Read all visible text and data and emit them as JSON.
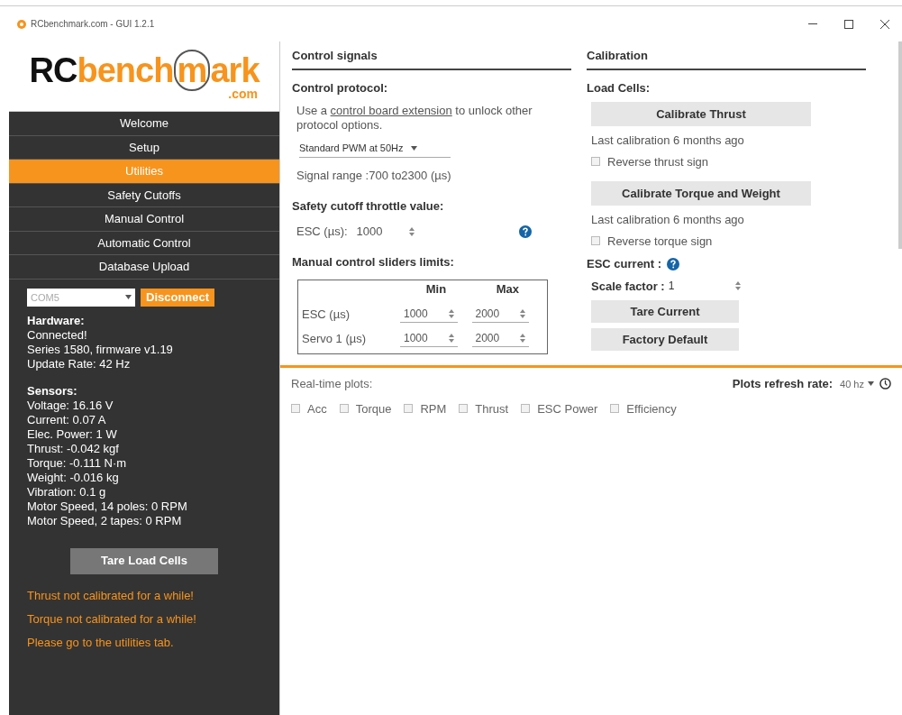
{
  "window": {
    "title": "RCbenchmark.com - GUI 1.2.1"
  },
  "logo": {
    "main": "RCbench",
    "accent": "m",
    "tail": "ark",
    "domain": ".com"
  },
  "nav": [
    {
      "label": "Welcome",
      "selected": false
    },
    {
      "label": "Setup",
      "selected": false
    },
    {
      "label": "Utilities",
      "selected": true
    },
    {
      "label": "Safety Cutoffs",
      "selected": false
    },
    {
      "label": "Manual Control",
      "selected": false
    },
    {
      "label": "Automatic Control",
      "selected": false
    },
    {
      "label": "Database Upload",
      "selected": false
    }
  ],
  "port": {
    "value": "COM5",
    "button": "Disconnect"
  },
  "hardware": {
    "title": "Hardware:",
    "lines": [
      "Connected!",
      "Series 1580, firmware v1.19",
      "Update Rate: 42 Hz"
    ]
  },
  "sensors": {
    "title": "Sensors:",
    "lines": [
      "Voltage: 16.16 V",
      "Current: 0.07 A",
      "Elec. Power: 1 W",
      "Thrust: -0.042 kgf",
      "Torque: -0.111 N·m",
      "Weight: -0.016 kg",
      "Vibration: 0.1 g",
      "Motor Speed, 14 poles: 0 RPM",
      "Motor Speed, 2 tapes: 0 RPM"
    ]
  },
  "tare_button": "Tare Load Cells",
  "warnings": [
    "Thrust not calibrated for a while!",
    "Torque not calibrated for a while!",
    "Please go to the utilities tab."
  ],
  "control_signals": {
    "title": "Control signals",
    "protocol_label": "Control protocol:",
    "hint_before": "Use a ",
    "hint_link": "control board extension",
    "hint_after": " to unlock other protocol options.",
    "protocol": "Standard PWM at 50Hz",
    "signal_range": "Signal range :700 to2300 (µs)",
    "cutoff_label": "Safety cutoff throttle value:",
    "cutoff_field": "ESC (µs):",
    "cutoff_value": "1000",
    "limits_label": "Manual control sliders limits:",
    "limits_columns": [
      "Min",
      "Max"
    ],
    "limits_rows": [
      {
        "label": "ESC (µs)",
        "min": "1000",
        "max": "2000"
      },
      {
        "label": "Servo 1 (µs)",
        "min": "1000",
        "max": "2000"
      }
    ]
  },
  "calibration": {
    "title": "Calibration",
    "load_cells_label": "Load Cells:",
    "groups": [
      {
        "button": "Calibrate Thrust",
        "note": "Last calibration 6 months ago",
        "checkbox": "Reverse thrust sign",
        "checked": false
      },
      {
        "button": "Calibrate Torque and Weight",
        "note": "Last calibration 6 months ago",
        "checkbox": "Reverse torque sign",
        "checked": false
      }
    ],
    "esc_label": "ESC current :",
    "scale_label": "Scale factor :",
    "scale_value": "1",
    "buttons": [
      "Tare Current",
      "Factory Default"
    ]
  },
  "plots": {
    "label": "Real-time plots:",
    "rate_label": "Plots refresh rate:",
    "rate": "40 hz",
    "options": [
      {
        "label": "Acc",
        "checked": false
      },
      {
        "label": "Torque",
        "checked": false
      },
      {
        "label": "RPM",
        "checked": false
      },
      {
        "label": "Thrust",
        "checked": false
      },
      {
        "label": "ESC Power",
        "checked": false
      },
      {
        "label": "Efficiency",
        "checked": false
      }
    ]
  }
}
